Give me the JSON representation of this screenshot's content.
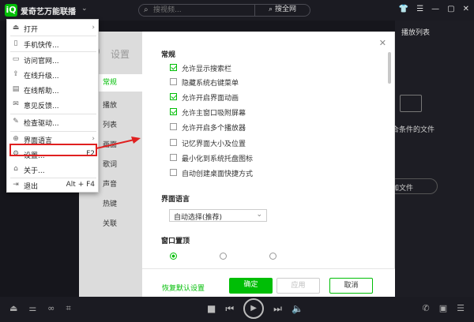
{
  "titlebar": {
    "logo_text": "iQ",
    "app_title": "爱奇艺万能联播",
    "search_placeholder": "搜视频...",
    "search_button": "搜全网"
  },
  "menu": {
    "items": [
      {
        "label": "打开",
        "icon": "folder-icon",
        "arrow": "›"
      },
      {
        "label": "手机快传...",
        "icon": "phone-icon"
      },
      {
        "label": "访问官网...",
        "icon": "globe-icon"
      },
      {
        "label": "在线升级...",
        "icon": "upgrade-icon"
      },
      {
        "label": "在线帮助...",
        "icon": "help-icon"
      },
      {
        "label": "意见反馈...",
        "icon": "feedback-icon"
      },
      {
        "label": "检查驱动...",
        "icon": "driver-icon"
      },
      {
        "label": "界面语言",
        "icon": "language-icon",
        "arrow": "›"
      },
      {
        "label": "设置...",
        "icon": "settings-icon",
        "shortcut": "F2"
      },
      {
        "label": "关于...",
        "icon": "about-icon"
      },
      {
        "label": "退出",
        "icon": "exit-icon",
        "shortcut": "Alt + F4"
      }
    ]
  },
  "settings": {
    "title": "设置",
    "sidebar": [
      "常规",
      "播放",
      "列表",
      "画面",
      "歌词",
      "声音",
      "热键",
      "关联"
    ],
    "sections": {
      "general": "常规",
      "language": "界面语言",
      "window_top": "窗口置顶"
    },
    "options": [
      {
        "label": "允许显示搜索栏",
        "checked": true
      },
      {
        "label": "隐藏系统右键菜单",
        "checked": false
      },
      {
        "label": "允许开启界面动画",
        "checked": true
      },
      {
        "label": "允许主窗口吸附屏幕",
        "checked": true
      },
      {
        "label": "允许开启多个播放器",
        "checked": false
      },
      {
        "label": "记忆界面大小及位置",
        "checked": false
      },
      {
        "label": "最小化到系统托盘图标",
        "checked": false
      },
      {
        "label": "自动创建桌面快捷方式",
        "checked": false
      }
    ],
    "language_value": "自动选择(推荐)",
    "footer": {
      "restore": "恢复默认设置",
      "ok": "确定",
      "apply": "应用",
      "cancel": "取消"
    }
  },
  "playlist": {
    "title": "播放列表",
    "text_conditions": "合条件的文件",
    "text_add": "加文件"
  },
  "colors": {
    "accent": "#00be06",
    "highlight": "#e02020"
  }
}
